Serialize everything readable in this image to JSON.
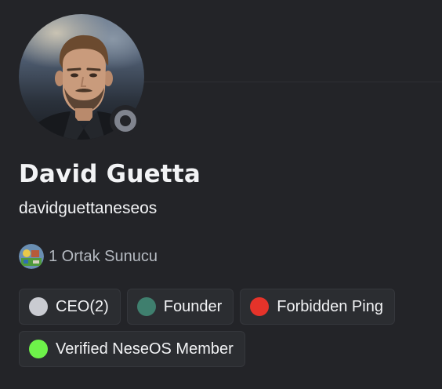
{
  "profile": {
    "display_name": "David Guetta",
    "username": "davidguettaneseos",
    "status": "offline",
    "status_color": "#80848e"
  },
  "mutual": {
    "label": "1 Ortak Sunucu"
  },
  "roles": [
    {
      "name": "CEO(2)",
      "color": "#c9cbd1"
    },
    {
      "name": "Founder",
      "color": "#3f7f6e"
    },
    {
      "name": "Forbidden Ping",
      "color": "#e5332a"
    },
    {
      "name": "Verified NeseOS Member",
      "color": "#6ef24a"
    }
  ],
  "theme": {
    "background": "#232428",
    "chip_background": "#2b2d31",
    "secondary_text": "#b5bac1"
  }
}
